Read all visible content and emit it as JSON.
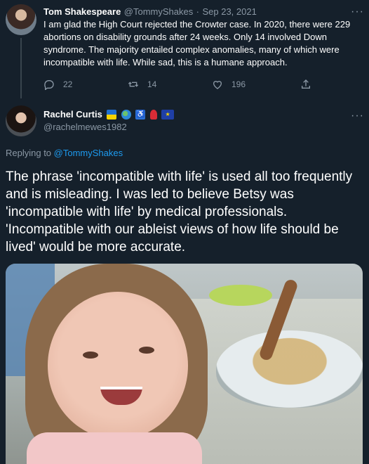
{
  "tweet1": {
    "author_name": "Tom Shakespeare",
    "handle": "@TommyShakes",
    "separator": "·",
    "date": "Sep 23, 2021",
    "text": "I am glad the High Court rejected the Crowter case. In 2020, there were 229 abortions on disability grounds after 24 weeks. Only 14 involved Down syndrome. The majority entailed complex anomalies, many of which were incompatible with life. While sad, this is a humane approach.",
    "replies": "22",
    "retweets": "14",
    "likes": "196"
  },
  "tweet2": {
    "author_name": "Rachel Curtis",
    "handle": "@rachelmewes1982",
    "replying_prefix": "Replying to",
    "replying_to": "@TommyShakes",
    "text": "The phrase 'incompatible with life' is used all too frequently and is misleading. I was led to believe Betsy was 'incompatible with life' by medical professionals. 'Incompatible with our ableist views of how life should be lived' would be more accurate.",
    "badges": [
      "ukraine-flag",
      "globe",
      "wheelchair",
      "rose",
      "eu-flag"
    ]
  },
  "colors": {
    "background": "#15202b",
    "muted": "#8b98a5",
    "link": "#1d9bf0",
    "divider": "#38444d"
  },
  "icons": [
    "more-icon",
    "reply-icon",
    "retweet-icon",
    "like-icon",
    "share-icon"
  ]
}
